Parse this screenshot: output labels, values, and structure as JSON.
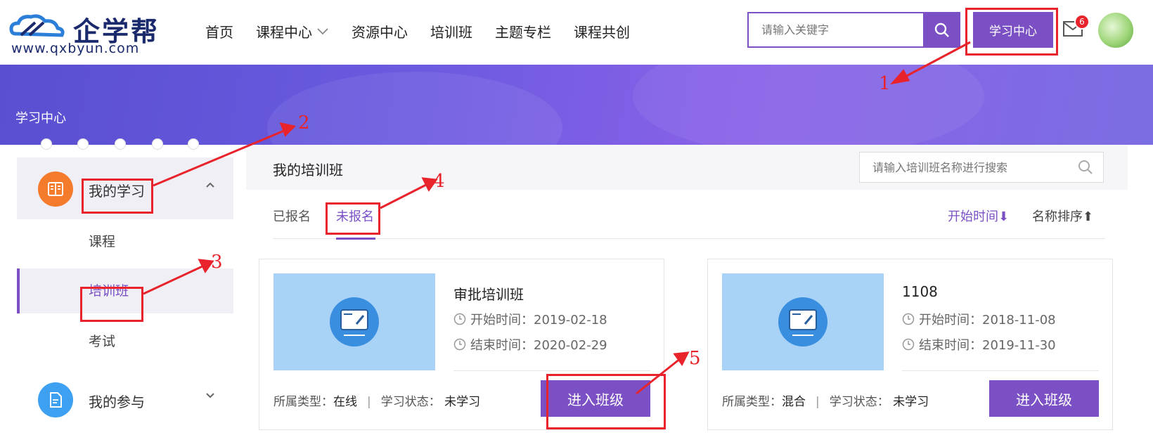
{
  "header": {
    "logo_text": "企学帮",
    "logo_url": "www.qxbyun.com",
    "nav": [
      "首页",
      "课程中心",
      "资源中心",
      "培训班",
      "主题专栏",
      "课程共创"
    ],
    "search_placeholder": "请输入关键字",
    "study_center_label": "学习中心",
    "mail_badge": "6"
  },
  "banner": {
    "title": "学习中心"
  },
  "sidebar": {
    "group1": "我的学习",
    "items": [
      "课程",
      "培训班",
      "考试"
    ],
    "group2": "我的参与"
  },
  "main": {
    "title": "我的培训班",
    "search_placeholder": "请输入培训班名称进行搜索",
    "tabs": [
      "已报名",
      "未报名"
    ],
    "sort_time": "开始时间",
    "sort_name": "名称排序"
  },
  "cards": [
    {
      "title": "审批培训班",
      "start": "开始时间：2019-02-18",
      "end": "结束时间：2020-02-29",
      "type_label": "所属类型：",
      "type": "在线",
      "status_label": "学习状态：",
      "status": "未学习",
      "button": "进入班级"
    },
    {
      "title": "1108",
      "start": "开始时间：2018-11-08",
      "end": "结束时间：2019-11-30",
      "type_label": "所属类型：",
      "type": "混合",
      "status_label": "学习状态：",
      "status": "未学习",
      "button": "进入班级"
    }
  ],
  "annotations": [
    "1",
    "2",
    "3",
    "4",
    "5"
  ],
  "colors": {
    "accent": "#7b50c4",
    "annotation": "#e8232c"
  }
}
